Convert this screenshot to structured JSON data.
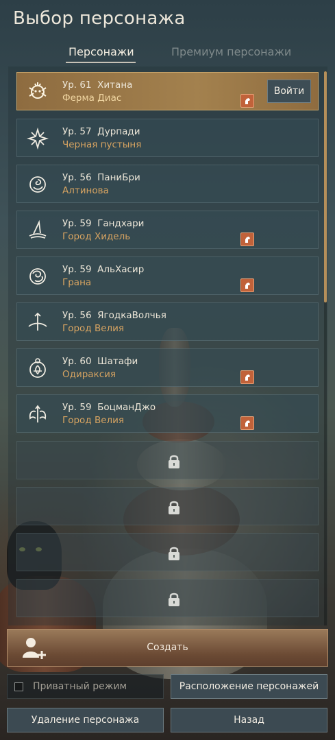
{
  "header": {
    "title": "Выбор персонажа"
  },
  "tabs": [
    {
      "label": "Персонажи",
      "active": true
    },
    {
      "label": "Премиум персонажи",
      "active": false
    }
  ],
  "characters": [
    {
      "level": "Ур. 61",
      "name": "Хитана",
      "location": "Ферма Диас",
      "icon": "class-emblem-hitana-icon",
      "horse_badge": true,
      "selected": true
    },
    {
      "level": "Ур. 57",
      "name": "Дурпади",
      "location": "Черная пустыня",
      "icon": "class-emblem-star-icon",
      "horse_badge": false
    },
    {
      "level": "Ур. 56",
      "name": "ПаниБри",
      "location": "Алтинова",
      "icon": "class-emblem-rose-icon",
      "horse_badge": false
    },
    {
      "level": "Ур. 59",
      "name": "Гандхари",
      "location": "Город Хидель",
      "icon": "class-emblem-wizard-hat-icon",
      "horse_badge": true
    },
    {
      "level": "Ур. 59",
      "name": "АльХасир",
      "location": "Грана",
      "icon": "class-emblem-swirl-icon",
      "horse_badge": true
    },
    {
      "level": "Ур. 56",
      "name": "ЯгодкаВолчья",
      "location": "Город Велия",
      "icon": "class-emblem-bow-icon",
      "horse_badge": false
    },
    {
      "level": "Ур. 60",
      "name": "Шатафи",
      "location": "Одираксия",
      "icon": "class-emblem-flower-icon",
      "horse_badge": true
    },
    {
      "level": "Ур. 59",
      "name": "БоцманДжо",
      "location": "Город Велия",
      "icon": "class-emblem-wings-icon",
      "horse_badge": true
    }
  ],
  "selected_actions": {
    "enter_label": "Войти"
  },
  "locked_slots_count": 4,
  "footer": {
    "create_label": "Создать",
    "private_mode_label": "Приватный режим",
    "private_mode_checked": false,
    "arrangement_label": "Расположение персонажей",
    "delete_label": "Удаление персонажа",
    "back_label": "Назад"
  },
  "colors": {
    "selected_slot": "#a3814e",
    "location_text": "#d6a361",
    "horse_badge": "#c1623a",
    "scrollbar": "#b58f5a"
  }
}
